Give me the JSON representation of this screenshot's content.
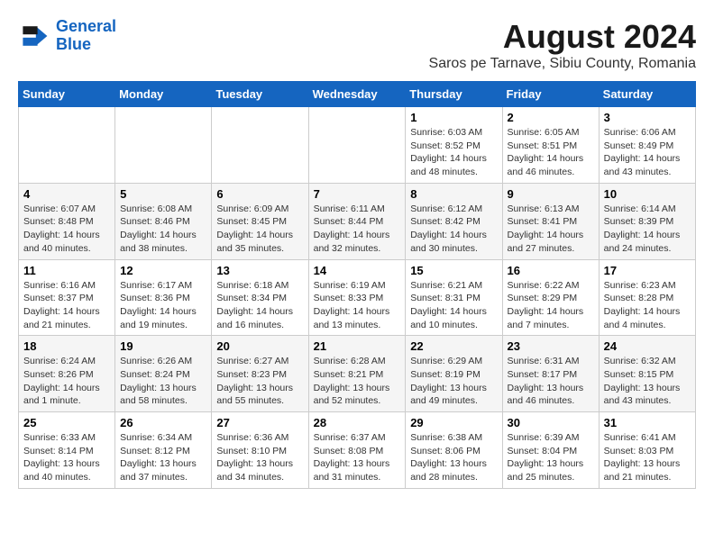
{
  "logo": {
    "line1": "General",
    "line2": "Blue"
  },
  "title": "August 2024",
  "subtitle": "Saros pe Tarnave, Sibiu County, Romania",
  "days_of_week": [
    "Sunday",
    "Monday",
    "Tuesday",
    "Wednesday",
    "Thursday",
    "Friday",
    "Saturday"
  ],
  "weeks": [
    [
      {
        "day": "",
        "info": ""
      },
      {
        "day": "",
        "info": ""
      },
      {
        "day": "",
        "info": ""
      },
      {
        "day": "",
        "info": ""
      },
      {
        "day": "1",
        "info": "Sunrise: 6:03 AM\nSunset: 8:52 PM\nDaylight: 14 hours\nand 48 minutes."
      },
      {
        "day": "2",
        "info": "Sunrise: 6:05 AM\nSunset: 8:51 PM\nDaylight: 14 hours\nand 46 minutes."
      },
      {
        "day": "3",
        "info": "Sunrise: 6:06 AM\nSunset: 8:49 PM\nDaylight: 14 hours\nand 43 minutes."
      }
    ],
    [
      {
        "day": "4",
        "info": "Sunrise: 6:07 AM\nSunset: 8:48 PM\nDaylight: 14 hours\nand 40 minutes."
      },
      {
        "day": "5",
        "info": "Sunrise: 6:08 AM\nSunset: 8:46 PM\nDaylight: 14 hours\nand 38 minutes."
      },
      {
        "day": "6",
        "info": "Sunrise: 6:09 AM\nSunset: 8:45 PM\nDaylight: 14 hours\nand 35 minutes."
      },
      {
        "day": "7",
        "info": "Sunrise: 6:11 AM\nSunset: 8:44 PM\nDaylight: 14 hours\nand 32 minutes."
      },
      {
        "day": "8",
        "info": "Sunrise: 6:12 AM\nSunset: 8:42 PM\nDaylight: 14 hours\nand 30 minutes."
      },
      {
        "day": "9",
        "info": "Sunrise: 6:13 AM\nSunset: 8:41 PM\nDaylight: 14 hours\nand 27 minutes."
      },
      {
        "day": "10",
        "info": "Sunrise: 6:14 AM\nSunset: 8:39 PM\nDaylight: 14 hours\nand 24 minutes."
      }
    ],
    [
      {
        "day": "11",
        "info": "Sunrise: 6:16 AM\nSunset: 8:37 PM\nDaylight: 14 hours\nand 21 minutes."
      },
      {
        "day": "12",
        "info": "Sunrise: 6:17 AM\nSunset: 8:36 PM\nDaylight: 14 hours\nand 19 minutes."
      },
      {
        "day": "13",
        "info": "Sunrise: 6:18 AM\nSunset: 8:34 PM\nDaylight: 14 hours\nand 16 minutes."
      },
      {
        "day": "14",
        "info": "Sunrise: 6:19 AM\nSunset: 8:33 PM\nDaylight: 14 hours\nand 13 minutes."
      },
      {
        "day": "15",
        "info": "Sunrise: 6:21 AM\nSunset: 8:31 PM\nDaylight: 14 hours\nand 10 minutes."
      },
      {
        "day": "16",
        "info": "Sunrise: 6:22 AM\nSunset: 8:29 PM\nDaylight: 14 hours\nand 7 minutes."
      },
      {
        "day": "17",
        "info": "Sunrise: 6:23 AM\nSunset: 8:28 PM\nDaylight: 14 hours\nand 4 minutes."
      }
    ],
    [
      {
        "day": "18",
        "info": "Sunrise: 6:24 AM\nSunset: 8:26 PM\nDaylight: 14 hours\nand 1 minute."
      },
      {
        "day": "19",
        "info": "Sunrise: 6:26 AM\nSunset: 8:24 PM\nDaylight: 13 hours\nand 58 minutes."
      },
      {
        "day": "20",
        "info": "Sunrise: 6:27 AM\nSunset: 8:23 PM\nDaylight: 13 hours\nand 55 minutes."
      },
      {
        "day": "21",
        "info": "Sunrise: 6:28 AM\nSunset: 8:21 PM\nDaylight: 13 hours\nand 52 minutes."
      },
      {
        "day": "22",
        "info": "Sunrise: 6:29 AM\nSunset: 8:19 PM\nDaylight: 13 hours\nand 49 minutes."
      },
      {
        "day": "23",
        "info": "Sunrise: 6:31 AM\nSunset: 8:17 PM\nDaylight: 13 hours\nand 46 minutes."
      },
      {
        "day": "24",
        "info": "Sunrise: 6:32 AM\nSunset: 8:15 PM\nDaylight: 13 hours\nand 43 minutes."
      }
    ],
    [
      {
        "day": "25",
        "info": "Sunrise: 6:33 AM\nSunset: 8:14 PM\nDaylight: 13 hours\nand 40 minutes."
      },
      {
        "day": "26",
        "info": "Sunrise: 6:34 AM\nSunset: 8:12 PM\nDaylight: 13 hours\nand 37 minutes."
      },
      {
        "day": "27",
        "info": "Sunrise: 6:36 AM\nSunset: 8:10 PM\nDaylight: 13 hours\nand 34 minutes."
      },
      {
        "day": "28",
        "info": "Sunrise: 6:37 AM\nSunset: 8:08 PM\nDaylight: 13 hours\nand 31 minutes."
      },
      {
        "day": "29",
        "info": "Sunrise: 6:38 AM\nSunset: 8:06 PM\nDaylight: 13 hours\nand 28 minutes."
      },
      {
        "day": "30",
        "info": "Sunrise: 6:39 AM\nSunset: 8:04 PM\nDaylight: 13 hours\nand 25 minutes."
      },
      {
        "day": "31",
        "info": "Sunrise: 6:41 AM\nSunset: 8:03 PM\nDaylight: 13 hours\nand 21 minutes."
      }
    ]
  ]
}
